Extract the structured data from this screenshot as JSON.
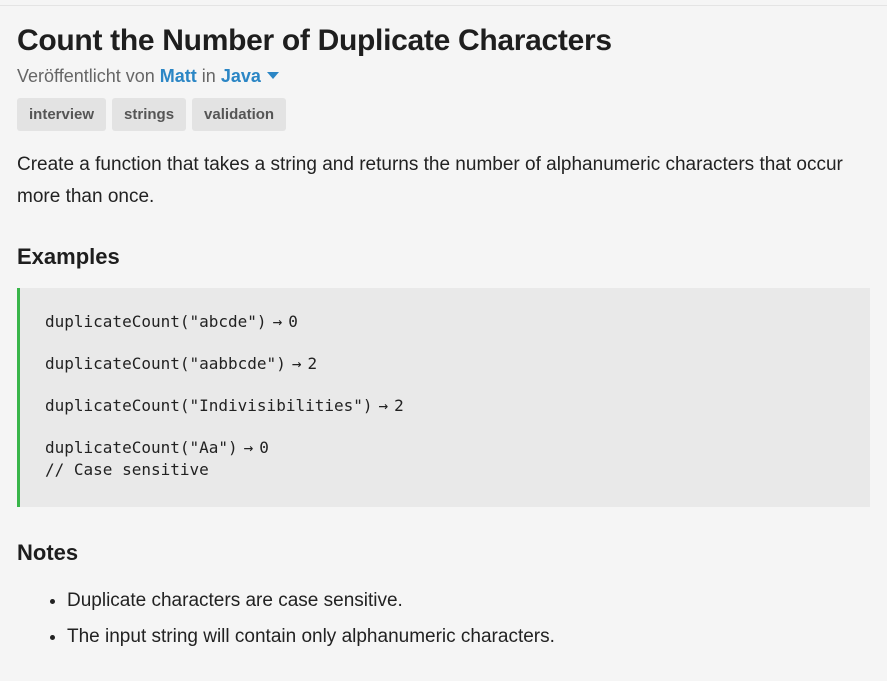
{
  "title": "Count the Number of Duplicate Characters",
  "meta": {
    "published_by": "Veröffentlicht von",
    "author": "Matt",
    "in": "in",
    "language": "Java"
  },
  "tags": [
    "interview",
    "strings",
    "validation"
  ],
  "description": "Create a function that takes a string and returns the number of alphanumeric characters that occur more than once.",
  "examples": {
    "heading": "Examples",
    "lines": [
      {
        "call": "duplicateCount(\"abcde\")",
        "arrow": "→",
        "result": "0",
        "comment": ""
      },
      {
        "call": "duplicateCount(\"aabbcde\")",
        "arrow": "→",
        "result": "2",
        "comment": ""
      },
      {
        "call": "duplicateCount(\"Indivisibilities\")",
        "arrow": "→",
        "result": "2",
        "comment": ""
      },
      {
        "call": "duplicateCount(\"Aa\")",
        "arrow": "→",
        "result": "0",
        "comment": "// Case sensitive"
      }
    ]
  },
  "notes": {
    "heading": "Notes",
    "items": [
      "Duplicate characters are case sensitive.",
      "The input string will contain only alphanumeric characters."
    ]
  },
  "colors": {
    "accent_link": "#2b86c5",
    "code_border": "#39b54a",
    "tag_bg": "#e3e3e3"
  }
}
